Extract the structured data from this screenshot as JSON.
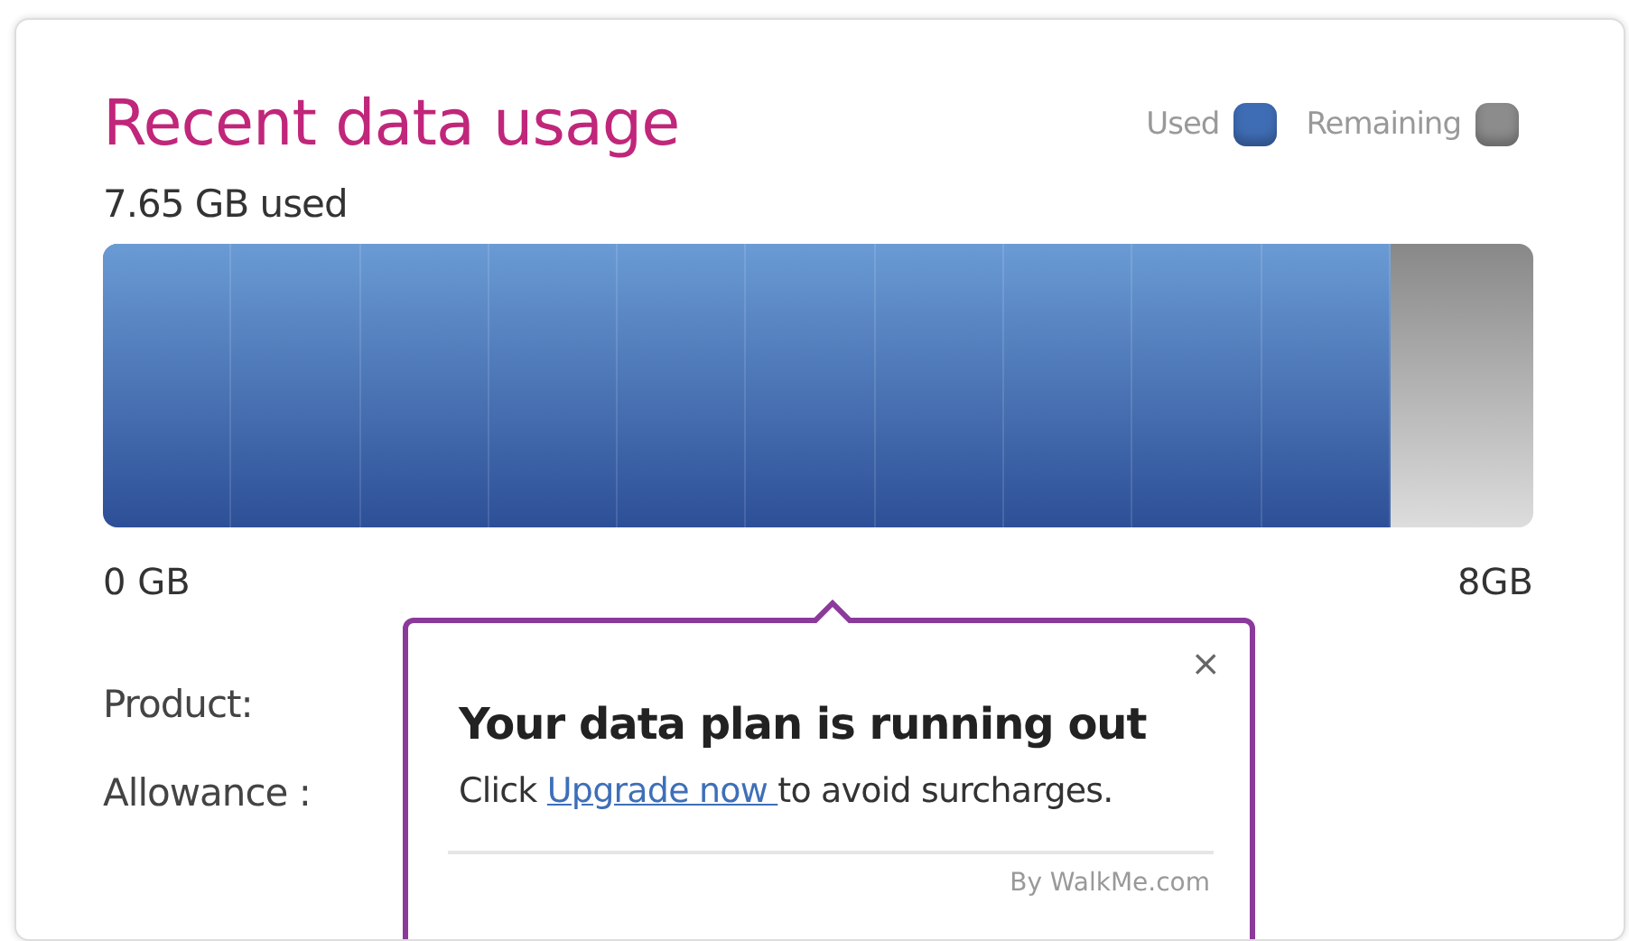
{
  "card": {
    "title": "Recent data usage",
    "legend": [
      {
        "label": "Used",
        "color": "#3f6db5"
      },
      {
        "label": "Remaining",
        "color": "#8c8c8c"
      }
    ],
    "used_text": "7.65 GB used"
  },
  "usage_bar": {
    "level": 0.9,
    "min_label": "0 GB",
    "max_label": "8GB"
  },
  "details": [
    {
      "label": "Product:"
    },
    {
      "label": "Allowance :"
    }
  ],
  "tooltip": {
    "close": "×",
    "title": "Your data plan is running out",
    "text_before": "Click ",
    "link": "Upgrade now ",
    "text_after": "to avoid surcharges.",
    "footer": "By WalkMe.com"
  }
}
